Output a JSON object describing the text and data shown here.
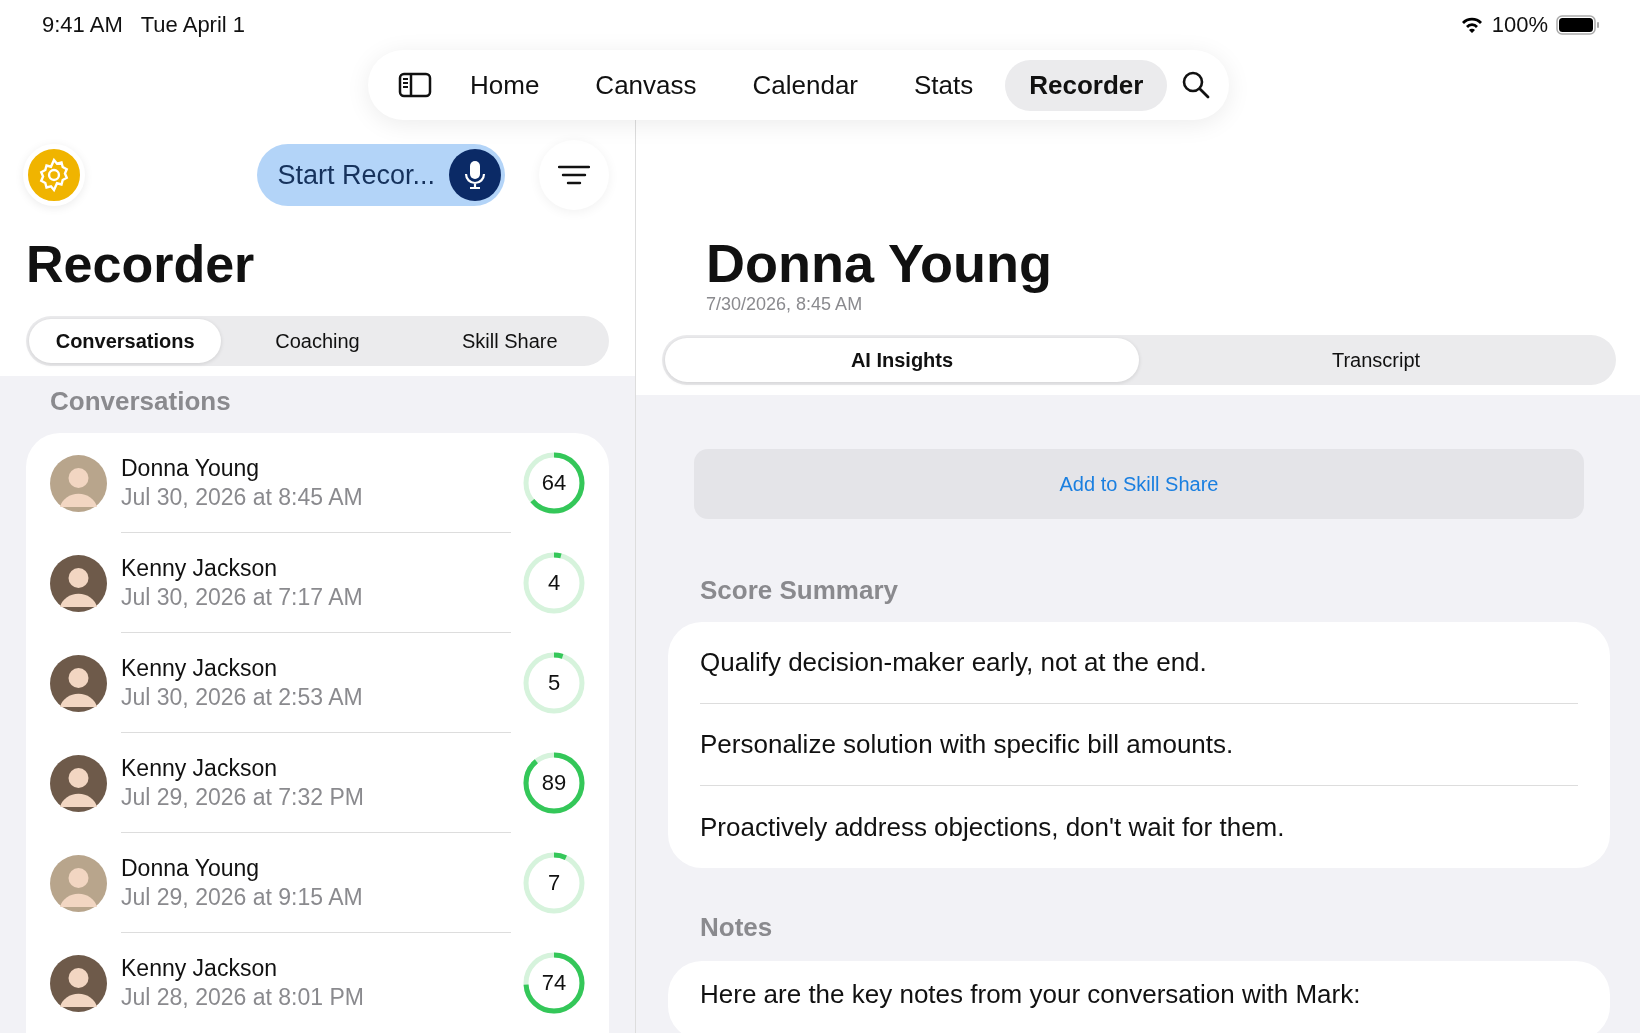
{
  "status_bar": {
    "time": "9:41 AM",
    "date": "Tue April 1",
    "battery": "100%"
  },
  "nav": {
    "items": [
      {
        "label": "Home",
        "selected": false
      },
      {
        "label": "Canvass",
        "selected": false
      },
      {
        "label": "Calendar",
        "selected": false
      },
      {
        "label": "Stats",
        "selected": false
      },
      {
        "label": "Recorder",
        "selected": true
      }
    ]
  },
  "sidebar": {
    "start_button": "Start Recor...",
    "title": "Recorder",
    "tabs": [
      {
        "label": "Conversations",
        "selected": true
      },
      {
        "label": "Coaching",
        "selected": false
      },
      {
        "label": "Skill Share",
        "selected": false
      }
    ],
    "section": "Conversations",
    "conversations": [
      {
        "name": "Donna Young",
        "date": "Jul 30, 2026 at 8:45 AM",
        "score": "64",
        "level": 0.64,
        "selected": false
      },
      {
        "name": "Kenny Jackson",
        "date": "Jul 30, 2026 at 7:17 AM",
        "score": "4",
        "level": 0.04,
        "selected": false
      },
      {
        "name": "Kenny Jackson",
        "date": "Jul 30, 2026 at 2:53 AM",
        "score": "5",
        "level": 0.05,
        "selected": false
      },
      {
        "name": "Kenny Jackson",
        "date": "Jul 29, 2026 at 7:32 PM",
        "score": "89",
        "level": 0.89,
        "selected": false
      },
      {
        "name": "Donna Young",
        "date": "Jul 29, 2026 at 9:15 AM",
        "score": "7",
        "level": 0.07,
        "selected": false
      },
      {
        "name": "Kenny Jackson",
        "date": "Jul 28, 2026 at 8:01 PM",
        "score": "74",
        "level": 0.74,
        "selected": false
      }
    ]
  },
  "detail": {
    "title": "Donna Young",
    "date": "7/30/2026, 8:45 AM",
    "tabs": [
      {
        "label": "AI Insights",
        "selected": true
      },
      {
        "label": "Transcript",
        "selected": false
      }
    ],
    "action_button": "Add to Skill Share",
    "score_summary": {
      "heading": "Score Summary",
      "items": [
        "Qualify decision-maker early, not at the end.",
        "Personalize solution with specific bill amounts.",
        "Proactively address objections, don't wait for them."
      ]
    },
    "notes": {
      "heading": "Notes",
      "text": "Here are the key notes from your conversation with Mark:"
    }
  }
}
